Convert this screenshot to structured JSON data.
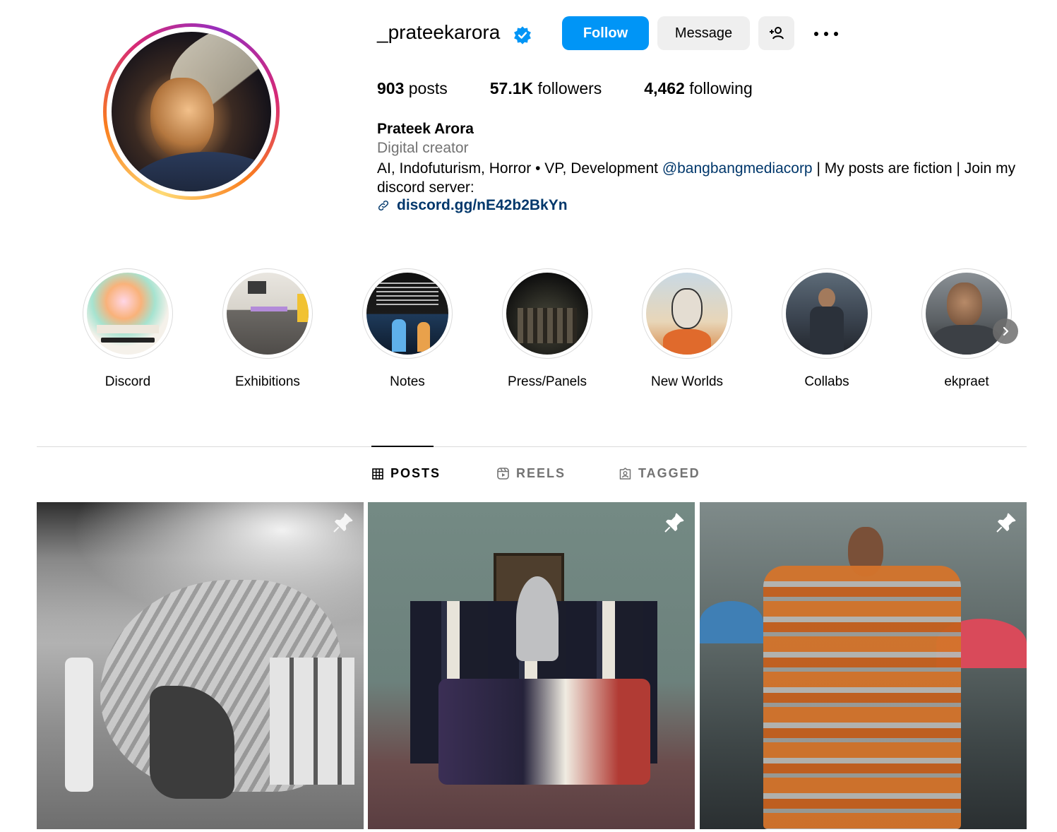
{
  "profile": {
    "username": "_prateekarora",
    "verified": true,
    "buttons": {
      "follow": "Follow",
      "message": "Message"
    },
    "stats": {
      "posts_value": "903",
      "posts_label": "posts",
      "followers_value": "57.1K",
      "followers_label": "followers",
      "following_value": "4,462",
      "following_label": "following"
    },
    "full_name": "Prateek Arora",
    "category": "Digital creator",
    "bio_before": "AI, Indofuturism, Horror • VP, Development ",
    "bio_mention": "@bangbangmediacorp",
    "bio_after": " | My posts are fiction | Join my discord server:",
    "link": "discord.gg/nE42b2BkYn"
  },
  "highlights": [
    {
      "label": "Discord"
    },
    {
      "label": "Exhibitions"
    },
    {
      "label": "Notes"
    },
    {
      "label": "Press/Panels"
    },
    {
      "label": "New Worlds"
    },
    {
      "label": "Collabs"
    },
    {
      "label": "ekpraet"
    }
  ],
  "tabs": {
    "posts": "POSTS",
    "reels": "REELS",
    "tagged": "TAGGED"
  },
  "colors": {
    "accent": "#0095f6",
    "link": "#00376b",
    "muted": "#737373",
    "button_bg": "#efefef"
  },
  "icons": [
    "verified-badge-icon",
    "add-user-icon",
    "more-options-icon",
    "link-icon",
    "chevron-right-icon",
    "grid-icon",
    "reels-icon",
    "tagged-icon",
    "pin-icon"
  ]
}
